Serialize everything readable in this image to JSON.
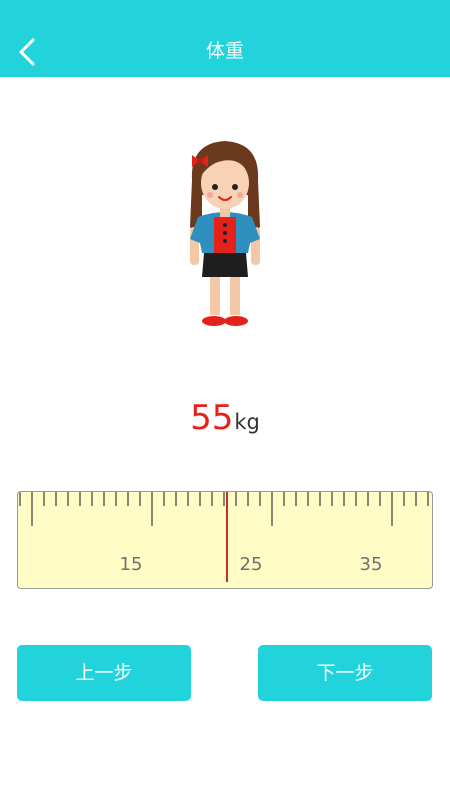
{
  "header": {
    "title": "体重",
    "back_icon": "chevron-left-icon",
    "background_color": "#22d3dc"
  },
  "avatar": {
    "icon": "girl-character-illustration"
  },
  "weight": {
    "value": "55",
    "unit": "kg",
    "value_color": "#e5211b"
  },
  "ruler": {
    "labels": [
      "15",
      "25",
      "35"
    ],
    "background_color": "#fffdc5",
    "indicator_color": "#c7302a"
  },
  "buttons": {
    "prev_label": "上一步",
    "next_label": "下一步",
    "color": "#22d3dc"
  }
}
